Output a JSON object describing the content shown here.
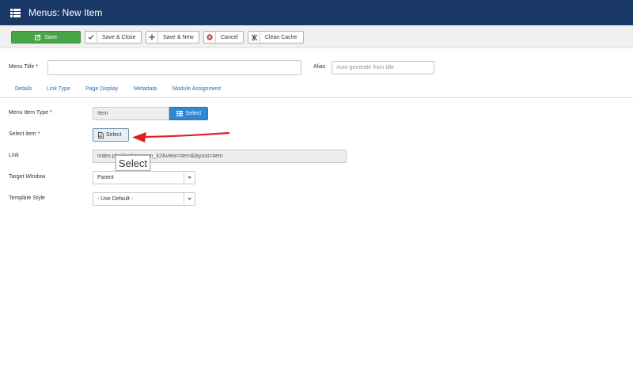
{
  "header": {
    "title": "Menus: New Item",
    "icon": "list-icon"
  },
  "toolbar": {
    "save": "Save",
    "save_close": "Save & Close",
    "save_new": "Save & New",
    "cancel": "Cancel",
    "clean_cache": "Clean Cache"
  },
  "form": {
    "menu_title_label": "Menu Title *",
    "menu_title_value": "",
    "alias_label": "Alias",
    "alias_placeholder": "Auto-generate from title"
  },
  "tabs": [
    "Details",
    "Link Type",
    "Page Display",
    "Metadata",
    "Module Assignment"
  ],
  "details": {
    "menu_item_type_label": "Menu Item Type *",
    "menu_item_type_value": "Item",
    "menu_item_type_button": "Select",
    "select_item_label": "Select item *",
    "select_item_button": "Select",
    "link_label": "Link",
    "link_value": "index.php?option=com_k2&view=item&layout=item",
    "target_window_label": "Target Window",
    "target_window_value": "Parent",
    "template_style_label": "Template Style",
    "template_style_value": "- Use Default -"
  },
  "tooltip": {
    "text": "Select"
  },
  "colors": {
    "header_bg": "#1a3867",
    "save_green": "#46a546",
    "select_blue": "#2f87d6",
    "annotation_red": "#e02020"
  }
}
